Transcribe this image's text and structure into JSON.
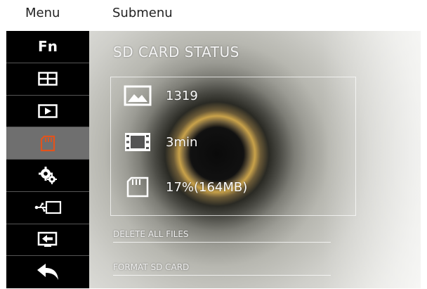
{
  "header": {
    "menu_label": "Menu",
    "submenu_label": "Submenu"
  },
  "sidebar": {
    "items": [
      {
        "label": "Fn",
        "icon": "fn-label"
      },
      {
        "icon": "split-view-icon"
      },
      {
        "icon": "playback-icon"
      },
      {
        "icon": "sd-card-icon",
        "active": true
      },
      {
        "icon": "settings-gears-icon"
      },
      {
        "icon": "usb-connection-icon"
      },
      {
        "icon": "export-icon"
      },
      {
        "icon": "back-arrow-icon"
      }
    ]
  },
  "panel": {
    "title": "SD CARD STATUS",
    "rows": [
      {
        "icon": "photo-icon",
        "value": "1319"
      },
      {
        "icon": "video-film-icon",
        "value": "3min"
      },
      {
        "icon": "sd-card-icon",
        "value": "17%(164MB)"
      }
    ],
    "actions": [
      {
        "label": "DELETE ALL FILES"
      },
      {
        "label": "FORMAT SD CARD"
      }
    ]
  },
  "colors": {
    "sidebar_bg": "#000000",
    "active_item_bg": "#6f6f6f",
    "active_icon": "#e2531c"
  }
}
